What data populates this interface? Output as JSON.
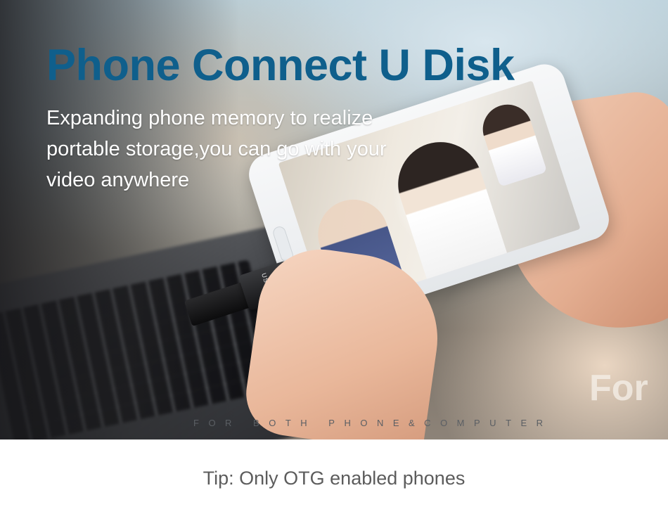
{
  "hero": {
    "title": "Phone Connect U Disk",
    "subtitle": "Expanding phone memory to realize portable storage,you can go with your video anywhere",
    "overlay_word": "For",
    "tagline": "FOR BOTH PHONE&COMPUTER",
    "device_brand": "USAMS"
  },
  "footer": {
    "tip": "Tip: Only OTG enabled phones"
  },
  "colors": {
    "title": "#0f5f8c",
    "subtitle": "#ffffff",
    "tip": "#5c5c5c",
    "tagline": "#5b5f64"
  }
}
